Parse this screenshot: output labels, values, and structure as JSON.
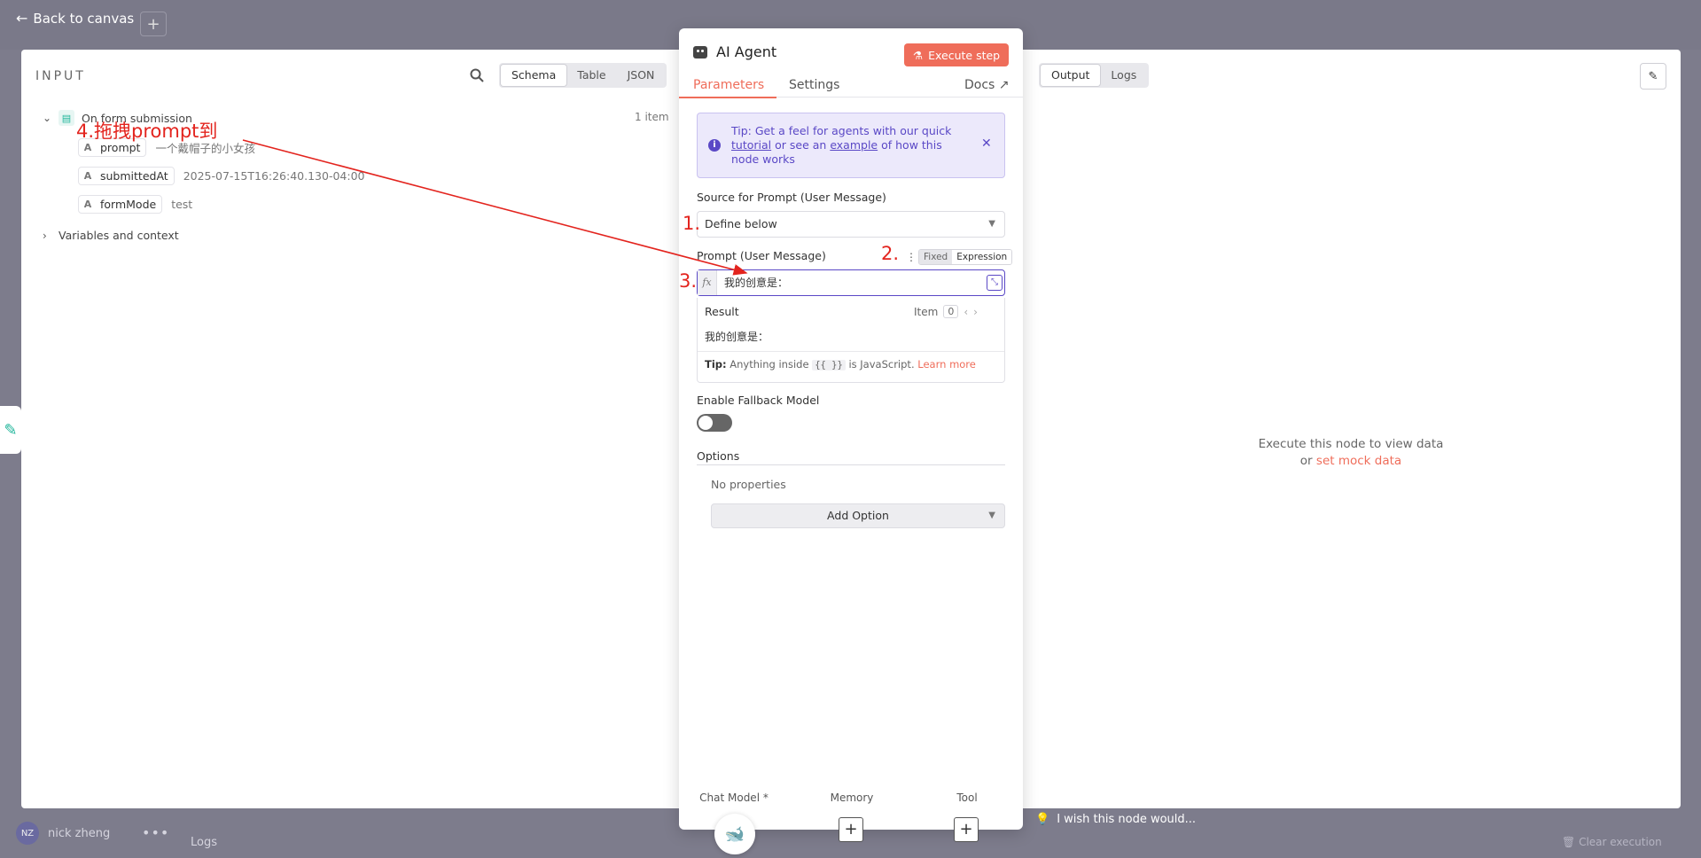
{
  "background": {
    "back_to_canvas": "Back to canvas",
    "user_initials": "NZ",
    "user_name": "nick zheng",
    "logs": "Logs",
    "clear_execution": "Clear execution",
    "wish_text": "I wish this node would..."
  },
  "input": {
    "title": "INPUT",
    "view_modes": [
      "Schema",
      "Table",
      "JSON"
    ],
    "active_view": "Schema",
    "node_name": "On form submission",
    "item_count": "1 item",
    "fields": [
      {
        "type": "A",
        "name": "prompt",
        "value": "一个戴帽子的小女孩"
      },
      {
        "type": "A",
        "name": "submittedAt",
        "value": "2025-07-15T16:26:40.130-04:00"
      },
      {
        "type": "A",
        "name": "formMode",
        "value": "test"
      }
    ],
    "variables_label": "Variables and context"
  },
  "node": {
    "title": "AI Agent",
    "execute_label": "Execute step",
    "tabs": [
      "Parameters",
      "Settings"
    ],
    "active_tab": "Parameters",
    "docs_label": "Docs",
    "tip": {
      "prefix": "Tip: Get a feel for agents with our quick",
      "link1": "tutorial",
      "mid": "or see an",
      "link2": "example",
      "suffix": "of how this node works"
    },
    "source_label": "Source for Prompt (User Message)",
    "source_value": "Define below",
    "prompt_label": "Prompt (User Message)",
    "mode_fixed": "Fixed",
    "mode_expression": "Expression",
    "fx": "fx",
    "prompt_value": "我的创意是：",
    "result": {
      "title": "Result",
      "item_label": "Item",
      "item_index": "0",
      "value": "我的创意是：",
      "tip_bold": "Tip:",
      "tip_pre": "Anything inside",
      "tip_code": "{{ }}",
      "tip_post": "is JavaScript.",
      "tip_link": "Learn more"
    },
    "fallback_label": "Enable Fallback Model",
    "options_label": "Options",
    "no_properties": "No properties",
    "add_option": "Add Option",
    "sub_nodes": [
      "Chat Model *",
      "Memory",
      "Tool"
    ]
  },
  "output": {
    "view_modes": [
      "Output",
      "Logs"
    ],
    "active_view": "Output",
    "message_line1": "Execute this node to view data",
    "message_or": "or",
    "message_link": "set mock data"
  },
  "annotations": {
    "step1": "1.",
    "step2": "2.",
    "step3": "3.",
    "step4": "4.拖拽prompt到"
  },
  "colors": {
    "accent": "#ef6d5a",
    "tip_purple": "#5a48c6",
    "annotation_red": "#e3241e"
  }
}
